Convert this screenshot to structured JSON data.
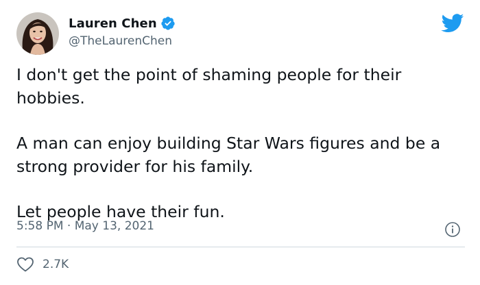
{
  "author": {
    "display_name": "Lauren Chen",
    "handle": "@TheLaurenChen",
    "verified": true,
    "avatar_icon": "profile-photo"
  },
  "brand": {
    "logo_icon": "twitter-bird-icon",
    "accent_color": "#1d9bf0"
  },
  "tweet": {
    "paragraphs": [
      "I don't get the point of shaming people for their hobbies.",
      "A man can enjoy building Star Wars figures and be a strong provider for his family.",
      "Let people have their fun."
    ],
    "timestamp": "5:58 PM · May 13, 2021"
  },
  "actions": {
    "info_icon": "info-icon",
    "like_icon": "heart-icon",
    "like_count": "2.7K"
  }
}
